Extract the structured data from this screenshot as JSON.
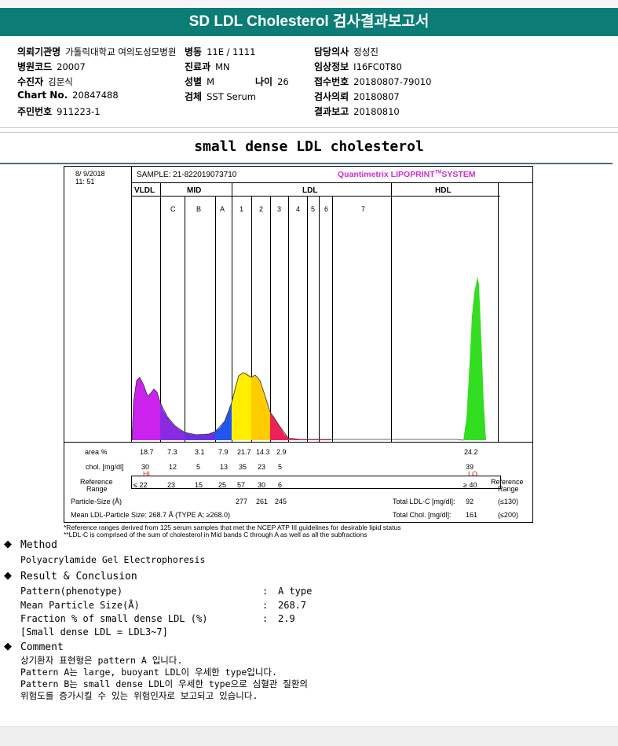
{
  "header": {
    "title": "SD LDL Cholesterol 검사결과보고서"
  },
  "patient_info": [
    {
      "key": "의뢰기관명",
      "value": "가톨릭대학교 여의도성모병원"
    },
    {
      "key": "병동",
      "value": "11E / 1111"
    },
    {
      "key": "담당의사",
      "value": "정성진"
    },
    {
      "key": "병원코드",
      "value": "20007"
    },
    {
      "key": "진료과",
      "value": "MN"
    },
    {
      "key": "임상정보",
      "value": "I16FC0T80"
    },
    {
      "key": "수진자",
      "value": "김문식"
    },
    {
      "key": "성별",
      "value": "M"
    },
    {
      "key": "나이",
      "value": "26"
    },
    {
      "key": "접수번호",
      "value": "20180807-79010"
    },
    {
      "key": "Chart No.",
      "value": "20847488"
    },
    {
      "key": "검체",
      "value": "SST Serum"
    },
    {
      "key": "검사의뢰",
      "value": "20180807"
    },
    {
      "key": "주민번호",
      "value": "911223-1"
    },
    {
      "key": "결과보고",
      "value": "20180810"
    }
  ],
  "section_title": "small dense LDL cholesterol",
  "report": {
    "date": "8/ 9/2018",
    "time": "11: 51",
    "sample": "SAMPLE:  21-822019073710",
    "system": "Quantimetrix LIPOPRINT",
    "system_tm": "TM",
    "system_suffix": "SYSTEM",
    "band_groups": [
      "VLDL",
      "MID",
      "LDL",
      "HDL"
    ],
    "bands": [
      "C",
      "B",
      "A",
      "1",
      "2",
      "3",
      "4",
      "5",
      "6",
      "7"
    ],
    "row_labels": {
      "area": "area %",
      "chol": "chol. [mg/dl]",
      "ref_line1": "Reference",
      "ref_line2": "Range",
      "particle": "Particle-Size (Å)",
      "mean": "Mean LDL-Particle Size:  268.7 Å  (TYPE A; ≥268.0)"
    },
    "area_values": [
      "18.7",
      "7.3",
      "3.1",
      "7.9",
      "21.7",
      "14.3",
      "2.9",
      "24.2"
    ],
    "chol_values": [
      "30",
      "12",
      "5",
      "13",
      "35",
      "23",
      "5",
      "39"
    ],
    "flags": {
      "vldl": "HI",
      "hdl": "LO"
    },
    "ref_values": [
      "≤  22",
      "23",
      "15",
      "25",
      "57",
      "30",
      "6",
      "≥ 40"
    ],
    "particle_values": [
      "277",
      "261",
      "245"
    ],
    "totals": {
      "ldl_label": "Total LDL-C [mg/dl]:",
      "ldl_value": "92",
      "ldl_ref": "(≤130)",
      "chol_label": "Total Chol. [mg/dl]:",
      "chol_value": "161",
      "chol_ref": "(≤200)"
    },
    "right_ref_line1": "Reference",
    "right_ref_line2": "Range"
  },
  "footnotes": [
    "*Reference ranges derived from 125 serum samples that met the NCEP ATP III guidelines for desirable lipid status",
    "**LDL-C is comprised of the sum of cholesterol in Mid bands C through A as well as all the subfractions"
  ],
  "method": {
    "heading": "Method",
    "text": "Polyacrylamide Gel Electrophoresis"
  },
  "result": {
    "heading": "Result & Conclusion",
    "rows": [
      {
        "label": "Pattern(phenotype)",
        "sep": ":",
        "value": "A type"
      },
      {
        "label": "Mean Particle Size(Å)",
        "sep": ":",
        "value": "268.7"
      },
      {
        "label": "Fraction % of small dense LDL (%)",
        "sep": ":",
        "value": "2.9"
      }
    ],
    "note": "[Small dense LDL = LDL3~7]"
  },
  "comment": {
    "heading": "Comment",
    "lines": [
      "상기환자 표현형은 pattern A 입니다.",
      "Pattern A는 large, buoyant LDL이 우세한 type입니다.",
      "Pattern B는 small dense LDL이 우세한 type으로 심혈관 질환의",
      "위험도를 증가시킬 수 있는 위험인자로 보고되고 있습니다."
    ]
  },
  "colors": {
    "banner": "#0b7c76",
    "vldl": "#cc22ee",
    "midC": "#8a2be2",
    "midB": "#5533dd",
    "midA": "#2255ee",
    "ldl1": "#ffee00",
    "ldl2": "#ffcc00",
    "ldl3": "#ff9900",
    "ldl4": "#ee2255",
    "hdl": "#33dd22"
  }
}
